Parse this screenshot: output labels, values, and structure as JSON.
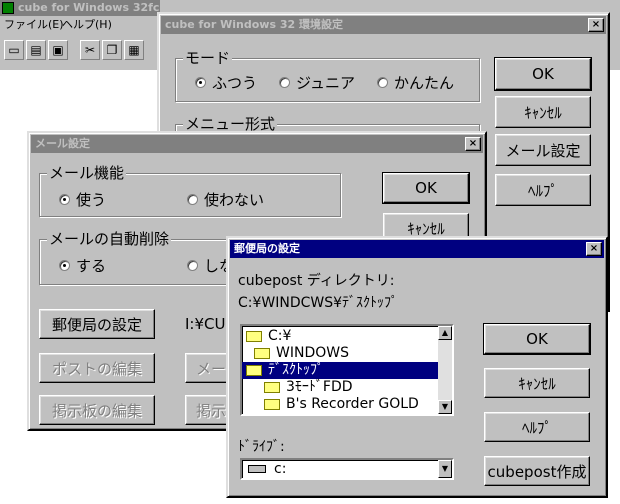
{
  "main_app": {
    "title": "cube for Windows 32fc",
    "menu": [
      "ファイル(E)",
      "ヘルプ(H)"
    ],
    "toolbar_icons": [
      "new-file-icon",
      "open-folder-icon",
      "save-icon",
      "cut-icon",
      "copy-icon",
      "paste-icon"
    ]
  },
  "env_dialog": {
    "title": "cube for Windows 32 環境設定",
    "close": "×",
    "mode_group": "モード",
    "mode_options": [
      "ふつう",
      "ジュニア",
      "かんたん"
    ],
    "mode_selected": 0,
    "menu_group": "メニュー形式",
    "buttons": {
      "ok": "OK",
      "cancel": "ｷｬﾝｾﾙ",
      "mail_settings": "メール設定",
      "help": "ﾍﾙﾌﾟ"
    }
  },
  "mail_dialog": {
    "title": "メール設定",
    "close": "×",
    "mail_function_group": "メール機能",
    "mail_function_options": [
      "使う",
      "使わない"
    ],
    "auto_delete_group": "メールの自動削除",
    "auto_delete_options": [
      "する",
      "しない"
    ],
    "buttons": {
      "ok": "OK",
      "cancel": "ｷｬﾝｾﾙ",
      "post_office": "郵便局の設定",
      "edit_post": "ポストの編集",
      "edit_board": "掲示板の編集",
      "mail_btn": "メー",
      "board_btn": "掲示"
    },
    "path_text": "I:¥CU"
  },
  "post_dialog": {
    "title": "郵便局の設定",
    "close": "×",
    "dir_label": "cubepost ディレクトリ:",
    "dir_path": "C:¥WINDCWS¥ﾃﾞｽｸﾄｯﾌﾟ",
    "folders": [
      "C:¥",
      "WINDOWS",
      "ﾃﾞｽｸﾄｯﾌﾟ",
      "3ﾓｰﾄﾞFDD",
      "B's Recorder GOLD"
    ],
    "selected_folder": 2,
    "drive_label": "ﾄﾞﾗｲﾌﾞ:",
    "drive_value": "c:",
    "buttons": {
      "ok": "OK",
      "cancel": "ｷｬﾝｾﾙ",
      "help": "ﾍﾙﾌﾟ",
      "create": "cubepost作成"
    }
  }
}
